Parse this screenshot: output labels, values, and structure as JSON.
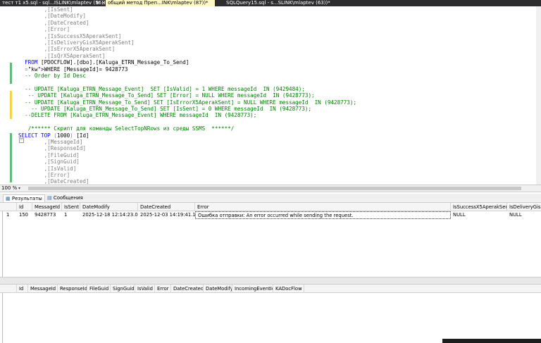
{
  "tabs": [
    {
      "label": "тест т1 x5.sql - sql...ISLINK\\mlaptev (56))*",
      "extra": "⊕",
      "close": "×",
      "active": false
    },
    {
      "label": "общий метод Преп...INK\\mlaptev (87))*",
      "active": true
    },
    {
      "label": "SQLQuery15.sql - s...SLINK\\mlaptev (63))*",
      "active": false
    }
  ],
  "editor": {
    "lines": [
      {
        "text": "        ,[IsSent]",
        "cls": "gray"
      },
      {
        "text": "        ,[DateModify]",
        "cls": "gray"
      },
      {
        "text": "        ,[DateCreated]",
        "cls": "gray"
      },
      {
        "text": "        ,[Error]",
        "cls": "gray"
      },
      {
        "text": "        ,[IsSuccessX5AperakSent]",
        "cls": "gray"
      },
      {
        "text": "        ,[IsDeliveryGisX5AperakSent]",
        "cls": "gray"
      },
      {
        "text": "        ,[IsErrorX5AperakSent]",
        "cls": "gray"
      },
      {
        "text": "        ,[IsQrX5AperakSent]",
        "cls": "gray"
      },
      {
        "text": "  FROM [PDOCFLOW].[dbo].[Kaluga_ETRN_Message_To_Send]",
        "cls": "mix_from"
      },
      {
        "text": "  WHERE [MessageId]= 9428773",
        "cls": "mix_where"
      },
      {
        "text": "  -- Order by Id Desc",
        "cls": "cm"
      },
      {
        "text": "",
        "cls": ""
      },
      {
        "text": "  -- UPDATE [Kaluga_ETRN_Message_Event]  SET [IsValid] = 1 WHERE messageId  IN (9429484);",
        "cls": "cm"
      },
      {
        "text": "   -- UPDATE [Kaluga_ETRN_Message_To_Send] SET [Error] = NULL WHERE messageId  IN (9428773);",
        "cls": "cm"
      },
      {
        "text": "  -- UPDATE [Kaluga_ETRN_Message_To_Send] SET [IsErrorX5AperakSent] = NULL WHERE messageId  IN (9428773);",
        "cls": "cm"
      },
      {
        "text": "    -- UPDATE [Kaluga_ETRN_Message_To_Send] SET [IsSent] = 0 WHERE messageId  IN (9428773);",
        "cls": "cm"
      },
      {
        "text": "  --DELETE FROM [Kaluga_ETRN_Message_Event] WHERE messageId  IN (9428773);",
        "cls": "cm"
      },
      {
        "text": "",
        "cls": ""
      },
      {
        "text": "   /****** Скрипт для команды SelectTopNRows из среды SSMS  ******/",
        "cls": "cm"
      },
      {
        "text": "SELECT TOP (1000) [Id]",
        "cls": "mix_select"
      },
      {
        "text": "        ,[MessageId]",
        "cls": "gray"
      },
      {
        "text": "        ,[ResponseId]",
        "cls": "gray"
      },
      {
        "text": "        ,[FileGuid]",
        "cls": "gray"
      },
      {
        "text": "        ,[SignGuid]",
        "cls": "gray"
      },
      {
        "text": "        ,[IsValid]",
        "cls": "gray"
      },
      {
        "text": "        ,[Error]",
        "cls": "gray"
      },
      {
        "text": "        ,[DateCreated]",
        "cls": "gray"
      }
    ]
  },
  "status": {
    "zoom": "100 %",
    "zoom_arrow": "▾"
  },
  "result_tabs": [
    {
      "label": "Результаты",
      "icon": "▦",
      "active": true
    },
    {
      "label": "Сообщения",
      "icon": "▤",
      "active": false
    }
  ],
  "grid1": {
    "columns": [
      "",
      "Id",
      "MessageId",
      "IsSent",
      "DateModify",
      "DateCreated",
      "Error",
      "IsSuccessX5AperakSent",
      "IsDeliveryGisX5A"
    ],
    "rows": [
      [
        "1",
        "150",
        "9428773",
        "1",
        "2025-12-18 12:14:23.037",
        "2025-12-03 14:19:41.110",
        "Ошибка отправки: An error occurred while sending the request.",
        "NULL",
        "NULL"
      ]
    ]
  },
  "grid2": {
    "columns": [
      "",
      "Id",
      "MessageId",
      "ResponseId",
      "FileGuid",
      "SignGuid",
      "IsValid",
      "Error",
      "DateCreated",
      "DateModify",
      "IncomingEventId",
      "KADocFlow"
    ]
  }
}
